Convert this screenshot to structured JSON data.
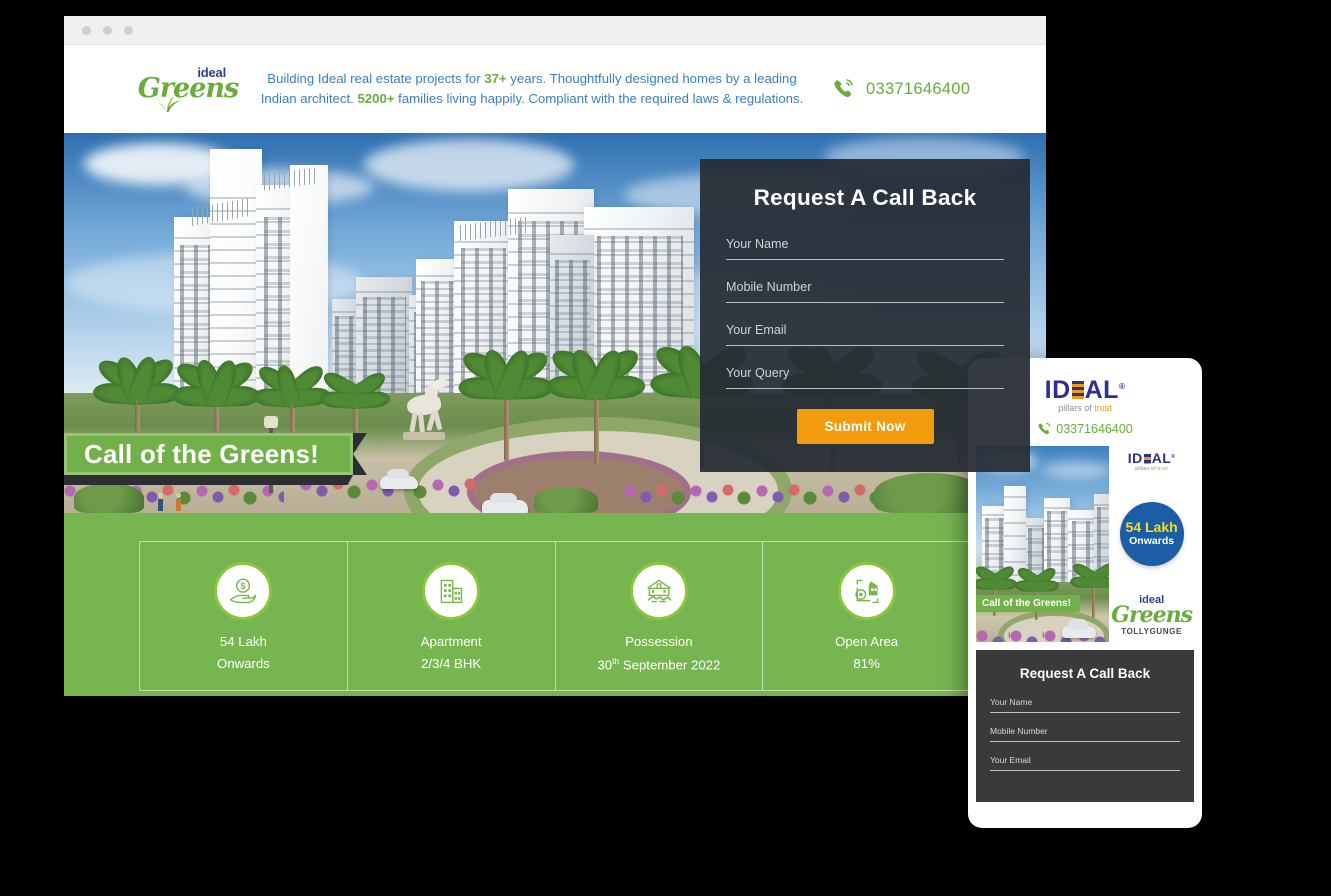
{
  "colors": {
    "green": "#77b551",
    "green_dark": "#6aad3c",
    "blue_text": "#3d7ec1",
    "navy": "#2e3091",
    "orange": "#f29b0c",
    "badge_blue": "#1b5ea5",
    "badge_yellow": "#ffd91f",
    "form_dark": "#262b34",
    "page_bg": "#000000"
  },
  "browser": {
    "dots": [
      "dot-1",
      "dot-2",
      "dot-3"
    ]
  },
  "desktop": {
    "logo": {
      "ideal": "ideal",
      "greens": "Greens",
      "icon": "grass-leaf-icon"
    },
    "headline": {
      "part1": "Building Ideal real estate projects for ",
      "years": "37+",
      "part2": " years. Thoughtfully designed homes by a leading Indian architect. ",
      "families": "5200+",
      "part3": " families living happily. Compliant with the required laws & regulations."
    },
    "phone": {
      "icon": "phone-ring-icon",
      "number": "03371646400"
    },
    "hero": {
      "ribbon_text": "Call of the Greens!",
      "alt": "ideal-greens-apartment-towers-render"
    },
    "callback_form": {
      "title": "Request A Call Back",
      "fields": [
        {
          "name": "name",
          "label": "Your Name",
          "placeholder": "Your Name",
          "value": ""
        },
        {
          "name": "mobile",
          "label": "Mobile Number",
          "placeholder": "Mobile Number",
          "value": ""
        },
        {
          "name": "email",
          "label": "Your Email",
          "placeholder": "Your Email",
          "value": ""
        },
        {
          "name": "query",
          "label": "Your Query",
          "placeholder": "Your Query",
          "value": ""
        }
      ],
      "submit_label": "Submit Now"
    },
    "features": [
      {
        "icon": "money-in-hand-icon",
        "line1": "54 Lakh",
        "line2": "Onwards",
        "line2_sup": ""
      },
      {
        "icon": "apartment-building-icon",
        "line1": "Apartment",
        "line2": "2/3/4 BHK",
        "line2_sup": ""
      },
      {
        "icon": "handshake-house-icon",
        "line1": "Possession",
        "line2_pre": "30",
        "line2_sup": "th",
        "line2": " September 2022"
      },
      {
        "icon": "measure-area-icon",
        "line1": "Open Area",
        "line2": "81%",
        "line2_sup": ""
      }
    ]
  },
  "mobile": {
    "logo": {
      "word": "ID",
      "word_end": "AL",
      "bars": "striped-e-icon",
      "registered": "®",
      "tagline_1": "pillars of ",
      "tagline_trust": "trust"
    },
    "phone": {
      "icon": "phone-ring-icon",
      "number": "03371646400"
    },
    "hero": {
      "ribbon_text": "Call of the Greens!",
      "badge_line1": "54 Lakh",
      "badge_line2": "Onwards",
      "greens_logo": {
        "ideal": "ideal",
        "greens": "Greens",
        "sub": "TOLLYGUNGE"
      }
    },
    "callback_form": {
      "title": "Request A Call Back",
      "fields": [
        {
          "name": "name",
          "label": "Your Name",
          "placeholder": "Your Name",
          "value": ""
        },
        {
          "name": "mobile",
          "label": "Mobile Number",
          "placeholder": "Mobile Number",
          "value": ""
        },
        {
          "name": "email",
          "label": "Your Email",
          "placeholder": "Your Email",
          "value": ""
        }
      ]
    }
  }
}
